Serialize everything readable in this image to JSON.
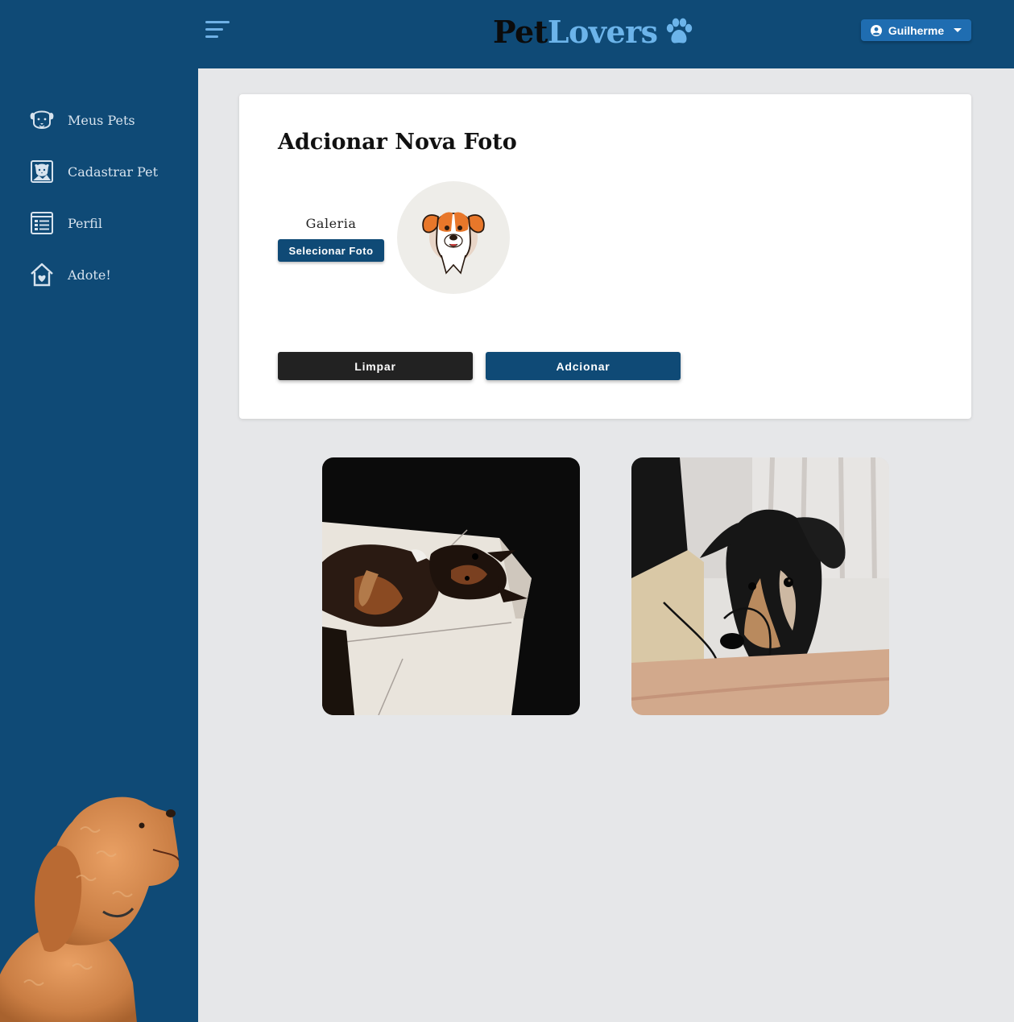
{
  "header": {
    "logo_part1": "Pet",
    "logo_part2": "Lovers",
    "user_name": "Guilherme",
    "menu_icon": "hamburger-menu-icon",
    "logo_icon": "paw-icon",
    "user_icon": "user-circle-icon",
    "dropdown_icon": "caret-down-icon"
  },
  "sidebar": {
    "items": [
      {
        "label": "Meus Pets",
        "icon": "dog-face-icon"
      },
      {
        "label": "Cadastrar Pet",
        "icon": "pet-photo-icon"
      },
      {
        "label": "Perfil",
        "icon": "profile-document-icon"
      },
      {
        "label": "Adote!",
        "icon": "house-heart-icon"
      }
    ],
    "illustration": "poodle-photo"
  },
  "form": {
    "title": "Adcionar Nova Foto",
    "gallery_label": "Galeria",
    "select_button": "Selecionar Foto",
    "clear_button": "Limpar",
    "add_button": "Adcionar",
    "preview": "dog-illustration-avatar"
  },
  "photos": [
    {
      "subject": "dog-lying-in-sunlight"
    },
    {
      "subject": "dog-looking-down"
    }
  ],
  "colors": {
    "primary": "#0f4a76",
    "accent": "#6cb4ea",
    "background": "#e6e7e9",
    "dark_button": "#222222",
    "user_button": "#1f6db1"
  }
}
